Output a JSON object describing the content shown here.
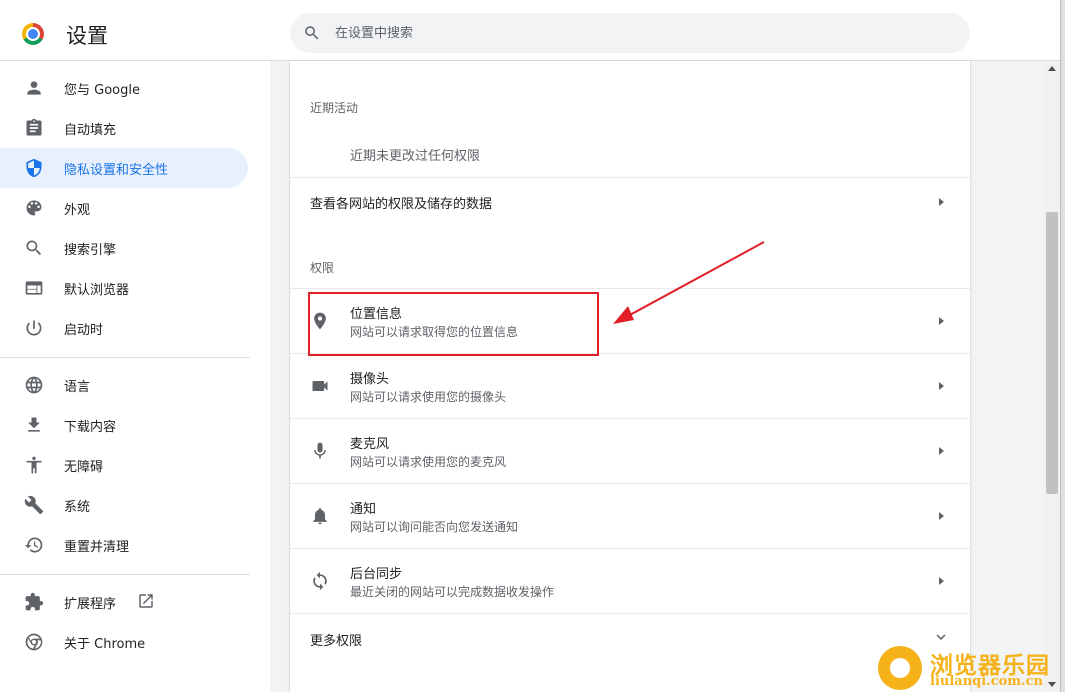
{
  "header": {
    "title": "设置",
    "search_placeholder": "在设置中搜索",
    "search_icon": "search-icon",
    "logo_icon": "chrome-logo-icon"
  },
  "sidebar": {
    "items": [
      {
        "label": "您与 Google",
        "icon": "person-icon"
      },
      {
        "label": "自动填充",
        "icon": "clipboard-icon"
      },
      {
        "label": "隐私设置和安全性",
        "icon": "shield-icon",
        "active": true
      },
      {
        "label": "外观",
        "icon": "palette-icon"
      },
      {
        "label": "搜索引擎",
        "icon": "search-icon"
      },
      {
        "label": "默认浏览器",
        "icon": "browser-window-icon"
      },
      {
        "label": "启动时",
        "icon": "power-icon"
      },
      {
        "label": "语言",
        "icon": "globe-icon"
      },
      {
        "label": "下载内容",
        "icon": "download-icon"
      },
      {
        "label": "无障碍",
        "icon": "accessibility-icon"
      },
      {
        "label": "系统",
        "icon": "wrench-icon"
      },
      {
        "label": "重置并清理",
        "icon": "history-reset-icon"
      },
      {
        "label": "扩展程序",
        "icon": "puzzle-icon",
        "extra_icon": "open-in-new-icon"
      },
      {
        "label": "关于 Chrome",
        "icon": "chrome-icon"
      }
    ]
  },
  "main": {
    "recent_activity": {
      "heading": "近期活动",
      "empty_text": "近期未更改过任何权限"
    },
    "view_all_link": "查看各网站的权限及储存的数据",
    "permissions": {
      "heading": "权限",
      "items": [
        {
          "title": "位置信息",
          "subtitle": "网站可以请求取得您的位置信息",
          "icon": "location-pin-icon",
          "highlighted": true
        },
        {
          "title": "摄像头",
          "subtitle": "网站可以请求使用您的摄像头",
          "icon": "videocam-icon"
        },
        {
          "title": "麦克风",
          "subtitle": "网站可以请求使用您的麦克风",
          "icon": "mic-icon"
        },
        {
          "title": "通知",
          "subtitle": "网站可以询问能否向您发送通知",
          "icon": "bell-icon"
        },
        {
          "title": "后台同步",
          "subtitle": "最近关闭的网站可以完成数据收发操作",
          "icon": "sync-icon"
        }
      ],
      "more_label": "更多权限",
      "more_icon": "chevron-down-icon"
    }
  },
  "annotation": {
    "color": "#e01f26"
  },
  "watermark": {
    "text_cn": "浏览器乐园",
    "text_url": "liulanqi.com.cn",
    "color": "#f6b21a"
  },
  "colors": {
    "accent": "#1a73e8",
    "active_bg": "#e8f0fe",
    "icon_grey": "#5f6368"
  }
}
